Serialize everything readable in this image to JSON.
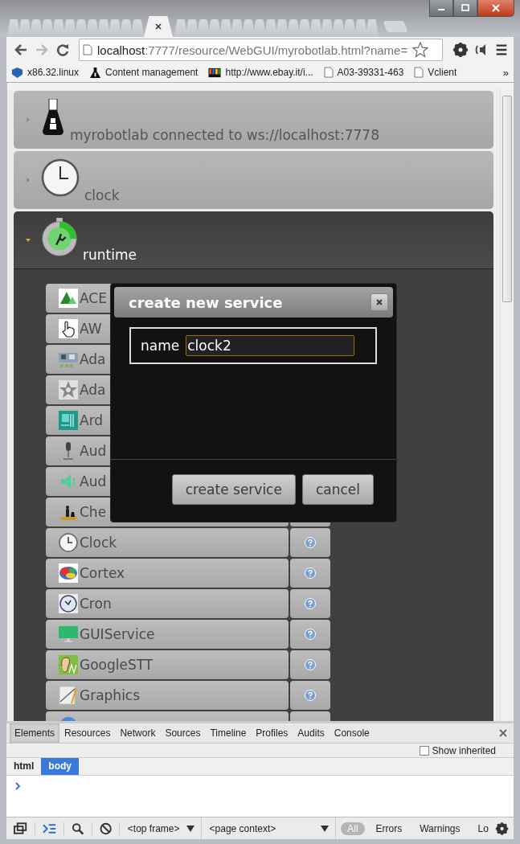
{
  "browser": {
    "tabs": [
      {
        "selected": false
      },
      {
        "selected": false
      },
      {
        "selected": false
      },
      {
        "selected": false
      },
      {
        "selected": false
      },
      {
        "selected": false
      },
      {
        "selected": false
      },
      {
        "selected": false
      },
      {
        "selected": false
      },
      {
        "selected": false
      },
      {
        "selected": false
      },
      {
        "selected": false
      },
      {
        "selected": true
      },
      {
        "selected": false
      },
      {
        "selected": false
      },
      {
        "selected": false
      },
      {
        "selected": false
      },
      {
        "selected": false
      },
      {
        "selected": false
      },
      {
        "selected": false
      },
      {
        "selected": false
      },
      {
        "selected": false
      },
      {
        "selected": false
      },
      {
        "selected": false
      },
      {
        "selected": false
      },
      {
        "selected": false
      },
      {
        "selected": false
      },
      {
        "selected": false
      },
      {
        "selected": false
      },
      {
        "selected": false
      },
      {
        "selected": false
      }
    ],
    "url_host": "localhost",
    "url_rest": ":7777/resource/WebGUI/myrobotlab.html?name=",
    "forward_disabled": true,
    "bookmarks": [
      {
        "label": "x86.32.linux"
      },
      {
        "label": "Content management"
      },
      {
        "label": "http://www.ebay.it/i..."
      },
      {
        "label": "A03-39331-463"
      },
      {
        "label": "Vclient"
      }
    ],
    "bookmarks_more": "»"
  },
  "panels": [
    {
      "title": "myrobotlab connected to ws://localhost:7778",
      "expanded": false
    },
    {
      "title": "clock",
      "expanded": false
    },
    {
      "title": "runtime",
      "expanded": true
    }
  ],
  "services": [
    {
      "name": "ACE"
    },
    {
      "name": "AW"
    },
    {
      "name": "Ada"
    },
    {
      "name": "Ada"
    },
    {
      "name": "Ard"
    },
    {
      "name": "Aud"
    },
    {
      "name": "Aud"
    },
    {
      "name": "Che",
      "help": false
    },
    {
      "name": "Clock",
      "help": true
    },
    {
      "name": "Cortex",
      "help": true
    },
    {
      "name": "Cron",
      "help": true
    },
    {
      "name": "GUIService",
      "help": true
    },
    {
      "name": "GoogleSTT",
      "help": true
    },
    {
      "name": "Graphics",
      "help": true
    },
    {
      "help": false
    }
  ],
  "dialog": {
    "title": "create new service",
    "label": "name",
    "value": "clock2",
    "buttons": [
      "create service",
      "cancel"
    ]
  },
  "devtools": {
    "tabs": [
      {
        "label": "Elements",
        "selected": true
      },
      {
        "label": "Resources",
        "selected": false
      },
      {
        "label": "Network",
        "selected": false
      },
      {
        "label": "Sources",
        "selected": false
      },
      {
        "label": "Timeline",
        "selected": false
      },
      {
        "label": "Profiles",
        "selected": false
      },
      {
        "label": "Audits",
        "selected": false
      },
      {
        "label": "Console",
        "selected": false
      }
    ],
    "show_inherited": {
      "label": "Show inherited",
      "checked": false
    },
    "breadcrumbs": [
      {
        "label": "html",
        "selected": false
      },
      {
        "label": "body",
        "selected": true
      }
    ],
    "frame": "<top frame>",
    "context": "<page context>",
    "filters": [
      {
        "label": "All",
        "selected": true
      },
      {
        "label": "Errors",
        "selected": false
      },
      {
        "label": "Warnings",
        "selected": false
      },
      {
        "label": "Lo",
        "selected": false
      }
    ]
  }
}
